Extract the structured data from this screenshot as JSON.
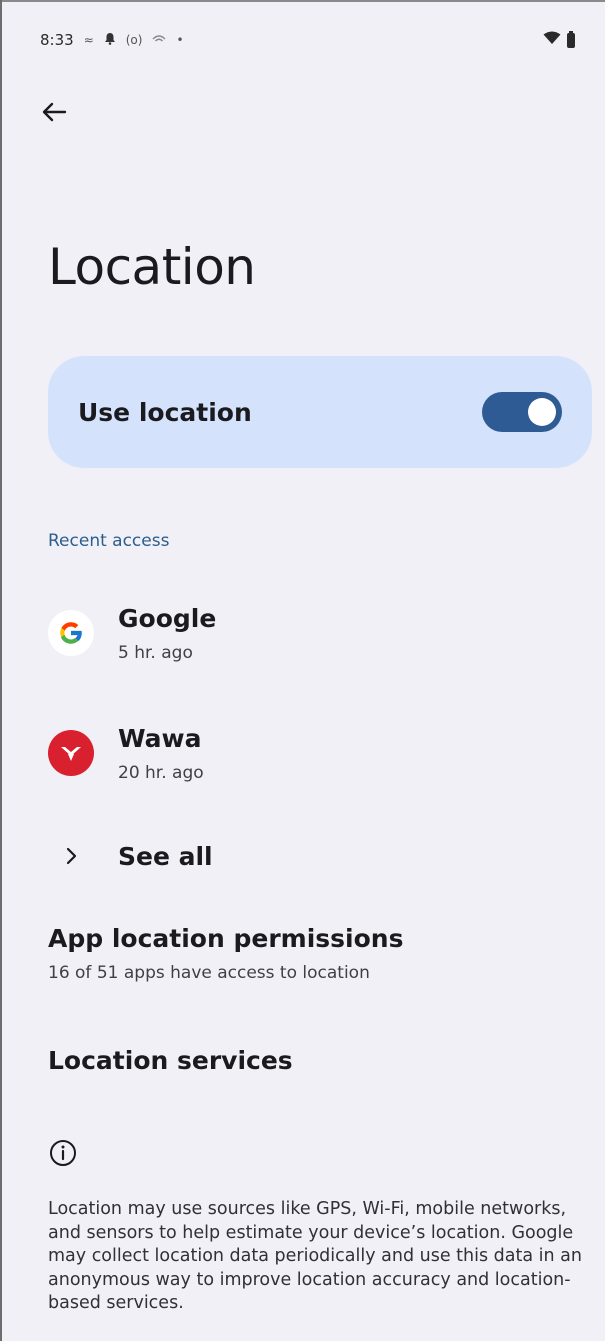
{
  "status_bar": {
    "time": "8:33",
    "left_icons": [
      "notification-icon",
      "bell-icon",
      "cast-icon",
      "signal-icon",
      "dot-icon"
    ],
    "right_icons": [
      "wifi-icon",
      "battery-icon"
    ]
  },
  "page": {
    "title": "Location"
  },
  "use_location": {
    "label": "Use location",
    "enabled": true,
    "accent_color": "#2f5b94",
    "card_color": "#d4e3fb"
  },
  "recent_access": {
    "header": "Recent access",
    "apps": [
      {
        "name": "Google",
        "time": "5 hr. ago",
        "icon": "google-icon"
      },
      {
        "name": "Wawa",
        "time": "20 hr. ago",
        "icon": "wawa-icon"
      }
    ],
    "see_all": "See all"
  },
  "app_permissions": {
    "title": "App location permissions",
    "subtitle": "16 of 51 apps have access to location"
  },
  "location_services": {
    "title": "Location services"
  },
  "footer": {
    "text": "Location may use sources like GPS, Wi-Fi, mobile networks, and sensors to help estimate your device’s location. Google may collect location data periodically and use this data in an anonymous way to improve location accuracy and location-based services."
  }
}
